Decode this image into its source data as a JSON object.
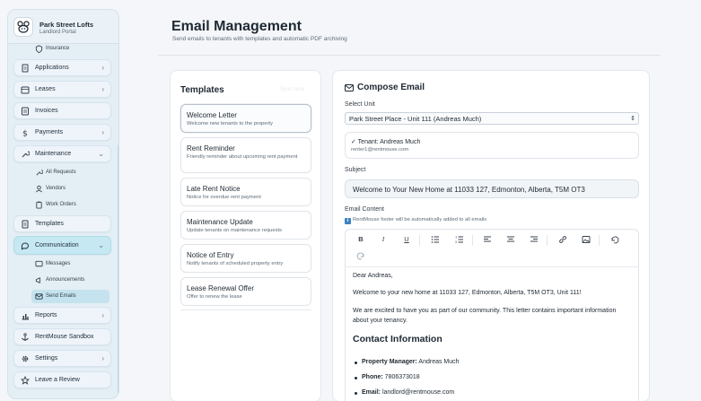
{
  "brand": {
    "title": "Park Street Lofts",
    "subtitle": "Landlord Portal"
  },
  "sidebar": {
    "partial_item": "Insurance",
    "items": [
      {
        "label": "Applications",
        "icon": "document-icon",
        "chevron": "›"
      },
      {
        "label": "Leases",
        "icon": "calendar-icon",
        "chevron": "›"
      },
      {
        "label": "Invoices",
        "icon": "invoice-icon"
      },
      {
        "label": "Payments",
        "icon": "dollar-icon",
        "chevron": "›"
      },
      {
        "label": "Maintenance",
        "icon": "wrench-icon",
        "chevron": "⌄"
      },
      {
        "label": "Templates",
        "icon": "document-icon"
      },
      {
        "label": "Communication",
        "icon": "chat-icon",
        "chevron": "⌄"
      },
      {
        "label": "Reports",
        "icon": "chart-icon",
        "chevron": "›"
      },
      {
        "label": "RentMouse Sandbox",
        "icon": "anchor-icon"
      },
      {
        "label": "Settings",
        "icon": "gear-icon",
        "chevron": "›"
      },
      {
        "label": "Leave a Review",
        "icon": "star-icon"
      }
    ],
    "maintenance_sub": [
      "All Requests",
      "Vendors",
      "Work Orders"
    ],
    "communication_sub": [
      "Messages",
      "Announcements",
      "Send Emails"
    ]
  },
  "header": {
    "title": "Email Management",
    "subtitle": "Send emails to tenants with templates and automatic PDF archiving"
  },
  "templates": {
    "title": "Templates",
    "faded": "Sync Now",
    "items": [
      {
        "name": "Welcome Letter",
        "desc": "Welcome new tenants to the property"
      },
      {
        "name": "Rent Reminder",
        "desc": "Friendly reminder about upcoming rent payment"
      },
      {
        "name": "Late Rent Notice",
        "desc": "Notice for overdue rent payment"
      },
      {
        "name": "Maintenance Update",
        "desc": "Update tenants on maintenance requests"
      },
      {
        "name": "Notice of Entry",
        "desc": "Notify tenants of scheduled property entry"
      },
      {
        "name": "Lease Renewal Offer",
        "desc": "Offer to renew the lease"
      }
    ]
  },
  "compose": {
    "title": "Compose Email",
    "select_unit_label": "Select Unit",
    "select_unit_value": "Park Street Place - Unit 111 (Andreas Much)",
    "tenant_name": "✓ Tenant: Andreas Much",
    "tenant_email": "renter1@rentmouse.com",
    "subject_label": "Subject",
    "subject_value": "Welcome to Your New Home at 11033 127, Edmonton, Alberta, T5M OT3",
    "content_label": "Email Content",
    "hint": "RentMouse footer will be automatically added to all emails",
    "hint_icon": "ℹ",
    "toolbar": {
      "bold": "B",
      "italic": "I",
      "underline": "U",
      "bullet_list": "bullet-list-icon",
      "numbered_list": "numbered-list-icon",
      "align_left": "align-left-icon",
      "align_center": "align-center-icon",
      "align_right": "align-right-icon",
      "link": "link-icon",
      "image": "image-icon",
      "undo": "undo-icon",
      "redo": "redo-icon"
    },
    "body": {
      "greeting": "Dear Andreas,",
      "p1": "Welcome to your new home at 11033 127, Edmonton, Alberta, T5M OT3, Unit 111!",
      "p2": "We are excited to have you as part of our community. This letter contains important information about your tenancy.",
      "heading": "Contact Information",
      "list": [
        {
          "label": "Property Manager:",
          "value": " Andreas Much"
        },
        {
          "label": "Phone:",
          "value": " 7806373018"
        },
        {
          "label": "Email:",
          "value": " landlord@rentmouse.com"
        }
      ]
    }
  }
}
